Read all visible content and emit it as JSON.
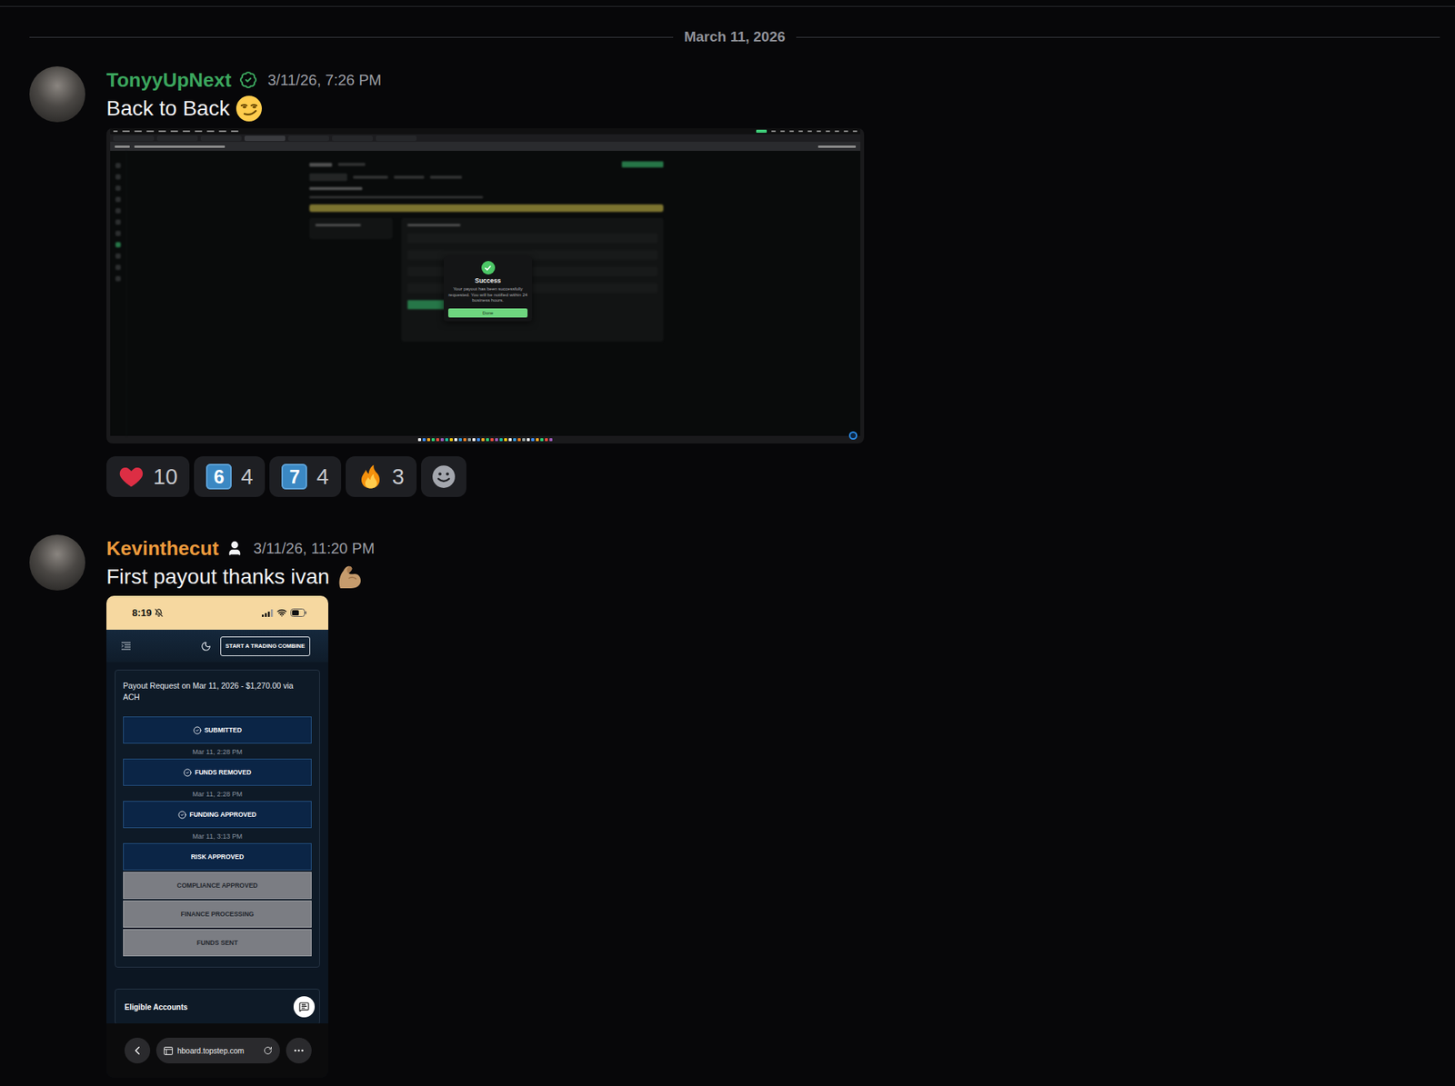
{
  "divider": {
    "date": "March 11, 2026"
  },
  "messages": [
    {
      "author": "TonyyUpNext",
      "color": "#3ba55d",
      "badge": "verified",
      "timestamp": "3/11/26, 7:26 PM",
      "text": "Back to Back",
      "emoji": "smirk",
      "attachment": {
        "kind": "desktop",
        "nav": [
          {
            "selected": false
          },
          {
            "selected": false
          },
          {
            "selected": false
          },
          {
            "selected": false
          },
          {
            "selected": false
          },
          {
            "selected": false
          },
          {
            "selected": false
          },
          {
            "selected": true
          },
          {
            "selected": false
          },
          {
            "selected": false
          },
          {
            "selected": false
          }
        ],
        "dialog": {
          "title": "Success",
          "body": "Your payout has been successfully requested. You will be notified within 24 business hours.",
          "button": "Done"
        }
      },
      "reactions": [
        {
          "kind": "heart",
          "label": "",
          "count": "10"
        },
        {
          "kind": "keycap",
          "label": "6",
          "count": "4"
        },
        {
          "kind": "keycap",
          "label": "7",
          "count": "4"
        },
        {
          "kind": "fire",
          "label": "",
          "count": "3"
        }
      ],
      "add_reaction": true
    },
    {
      "author": "Kevinthecut",
      "color": "#ec9a3c",
      "badge": "member",
      "timestamp": "3/11/26, 11:20 PM",
      "text": "First payout thanks ivan",
      "emoji": "flex",
      "attachment": {
        "kind": "phone",
        "status_time": "8:19",
        "header_button": "START A TRADING COMBINE",
        "payout_title": "Payout Request on Mar 11, 2026 - $1,270.00 via ACH",
        "steps": [
          {
            "label": "SUBMITTED",
            "completed": true,
            "reached": true,
            "time": "Mar 11, 2:28 PM"
          },
          {
            "label": "FUNDS REMOVED",
            "completed": true,
            "reached": true,
            "time": "Mar 11, 2:28 PM"
          },
          {
            "label": "FUNDING APPROVED",
            "completed": true,
            "reached": true,
            "time": "Mar 11, 3:13 PM"
          },
          {
            "label": "RISK APPROVED",
            "completed": false,
            "reached": true,
            "time": ""
          },
          {
            "label": "COMPLIANCE APPROVED",
            "completed": false,
            "reached": false,
            "time": ""
          },
          {
            "label": "FINANCE PROCESSING",
            "completed": false,
            "reached": false,
            "time": ""
          },
          {
            "label": "FUNDS SENT",
            "completed": false,
            "reached": false,
            "time": ""
          }
        ],
        "section_title": "Eligible Accounts",
        "url": "hboard.topstep.com"
      },
      "reactions": [],
      "add_reaction": false
    }
  ]
}
